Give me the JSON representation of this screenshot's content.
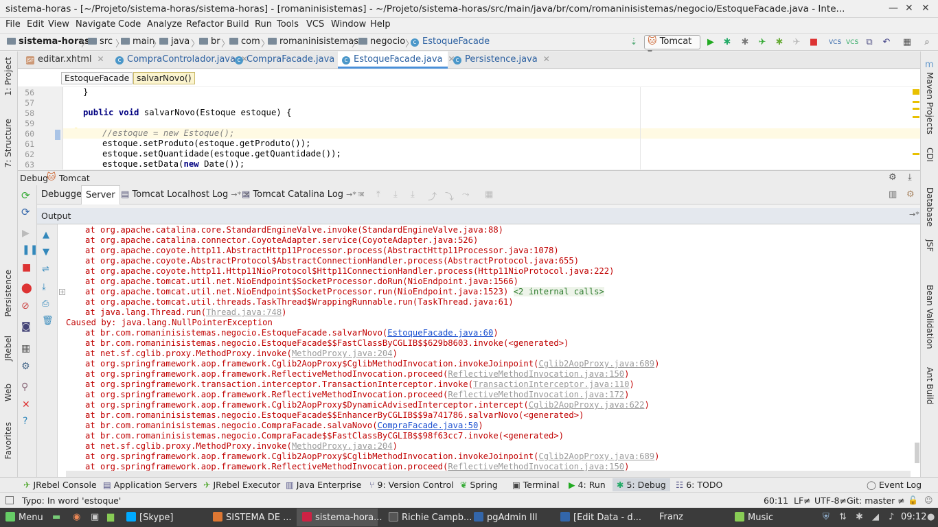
{
  "window": {
    "title": "sistema-horas - [~/Projeto/sistema-horas/sistema-horas] - [romaninisistemas] - ~/Projeto/sistema-horas/src/main/java/br/com/romaninisistemas/negocio/EstoqueFacade.java - Inte..."
  },
  "menu": [
    "File",
    "Edit",
    "View",
    "Navigate",
    "Code",
    "Analyze",
    "Refactor",
    "Build",
    "Run",
    "Tools",
    "VCS",
    "Window",
    "Help"
  ],
  "breadcrumb": [
    "sistema-horas",
    "src",
    "main",
    "java",
    "br",
    "com",
    "romaninisistemas",
    "negocio",
    "EstoqueFacade"
  ],
  "run_config": "Tomcat",
  "editor_tabs": [
    "editar.xhtml",
    "CompraControlador.java",
    "CompraFacade.java",
    "EstoqueFacade.java",
    "Persistence.java"
  ],
  "code_breadcrumb": [
    "EstoqueFacade",
    "salvarNovo()"
  ],
  "code": {
    "line_numbers": [
      "56",
      "57",
      "58",
      "59",
      "60",
      "61",
      "62",
      "63"
    ],
    "l56": "}",
    "l58_kw1": "public",
    "l58_kw2": "void",
    "l58_rest": "salvarNovo(Estoque estoque) {",
    "l60": "//estoque = new Estoque();",
    "l61": "estoque.setProduto(estoque.getProduto());",
    "l62": "estoque.setQuantidade(estoque.getQuantidade());",
    "l63_a": "estoque.setData(",
    "l63_kw": "new",
    "l63_b": " Date());"
  },
  "debug": {
    "label": "Debug",
    "config": "Tomcat",
    "tabs": [
      "Debugger",
      "Server",
      "Tomcat Localhost Log",
      "Tomcat Catalina Log"
    ],
    "output_label": "Output"
  },
  "console": {
    "l1": "at org.apache.catalina.core.StandardEngineValve.invoke(StandardEngineValve.java:88)",
    "l2": "at org.apache.catalina.connector.CoyoteAdapter.service(CoyoteAdapter.java:526)",
    "l3": "at org.apache.coyote.http11.AbstractHttp11Processor.process(AbstractHttp11Processor.java:1078)",
    "l4": "at org.apache.coyote.AbstractProtocol$AbstractConnectionHandler.process(AbstractProtocol.java:655)",
    "l5": "at org.apache.coyote.http11.Http11NioProtocol$Http11ConnectionHandler.process(Http11NioProtocol.java:222)",
    "l6": "at org.apache.tomcat.util.net.NioEndpoint$SocketProcessor.doRun(NioEndpoint.java:1566)",
    "l7": "at org.apache.tomcat.util.net.NioEndpoint$SocketProcessor.run(NioEndpoint.java:1523)",
    "l7_internal": "<2 internal calls>",
    "l8": "at org.apache.tomcat.util.threads.TaskThread$WrappingRunnable.run(TaskThread.java:61)",
    "l9a": "at java.lang.Thread.run(",
    "l9link": "Thread.java:748",
    "caused": "Caused by: java.lang.NullPointerException",
    "l10a": "at br.com.romaninisistemas.negocio.EstoqueFacade.salvarNovo(",
    "l10link": "EstoqueFacade.java:60",
    "l11": "at br.com.romaninisistemas.negocio.EstoqueFacade$$FastClassByCGLIB$$629b8603.invoke(<generated>)",
    "l12a": "at net.sf.cglib.proxy.MethodProxy.invoke(",
    "l12link": "MethodProxy.java:204",
    "l13a": "at org.springframework.aop.framework.Cglib2AopProxy$CglibMethodInvocation.invokeJoinpoint(",
    "l13link": "Cglib2AopProxy.java:689",
    "l14a": "at org.springframework.aop.framework.ReflectiveMethodInvocation.proceed(",
    "l14link": "ReflectiveMethodInvocation.java:150",
    "l15a": "at org.springframework.transaction.interceptor.TransactionInterceptor.invoke(",
    "l15link": "TransactionInterceptor.java:110",
    "l16a": "at org.springframework.aop.framework.ReflectiveMethodInvocation.proceed(",
    "l16link": "ReflectiveMethodInvocation.java:172",
    "l17a": "at org.springframework.aop.framework.Cglib2AopProxy$DynamicAdvisedInterceptor.intercept(",
    "l17link": "Cglib2AopProxy.java:622",
    "l18": "at br.com.romaninisistemas.negocio.EstoqueFacade$$EnhancerByCGLIB$$9a741786.salvarNovo(<generated>)",
    "l19a": "at br.com.romaninisistemas.negocio.CompraFacade.salvaNovo(",
    "l19link": "CompraFacade.java:50",
    "l20": "at br.com.romaninisistemas.negocio.CompraFacade$$FastClassByCGLIB$$98f63cc7.invoke(<generated>)",
    "l21a": "at net.sf.cglib.proxy.MethodProxy.invoke(",
    "l21link": "MethodProxy.java:204",
    "l22a": "at org.springframework.aop.framework.Cglib2AopProxy$CglibMethodInvocation.invokeJoinpoint(",
    "l22link": "Cglib2AopProxy.java:689",
    "l23a": "at org.springframework.aop.framework.ReflectiveMethodInvocation.proceed(",
    "l23link": "ReflectiveMethodInvocation.java:150"
  },
  "left_tools": [
    "1: Project",
    "7: Structure",
    "Persistence",
    "JRebel",
    "Web",
    "Favorites"
  ],
  "right_tools": [
    "Maven Projects",
    "CDI",
    "Database",
    "JSF",
    "Bean Validation",
    "Ant Build"
  ],
  "bottom_tools": [
    "JRebel Console",
    "Application Servers",
    "JRebel Executor",
    "Java Enterprise",
    "9: Version Control",
    "Spring",
    "Terminal",
    "4: Run",
    "5: Debug",
    "6: TODO",
    "Event Log"
  ],
  "status": {
    "message": "Typo: In word 'estoque'",
    "position": "60:11",
    "line_sep": "LF≠",
    "encoding": "UTF-8≠",
    "git": "Git: master ≠"
  },
  "taskbar": {
    "menu": "Menu",
    "items": [
      "[Skype]",
      "SISTEMA DE ...",
      "sistema-hora...",
      "Richie Campb...",
      "pgAdmin III",
      "[Edit Data - d...",
      "Franz",
      "Music"
    ],
    "clock": "09:12"
  },
  "colors": {
    "accent": "#4a90d9",
    "error_text": "#c00000",
    "link": "#1a4fd0",
    "taskbar": "#3b3b3b"
  }
}
